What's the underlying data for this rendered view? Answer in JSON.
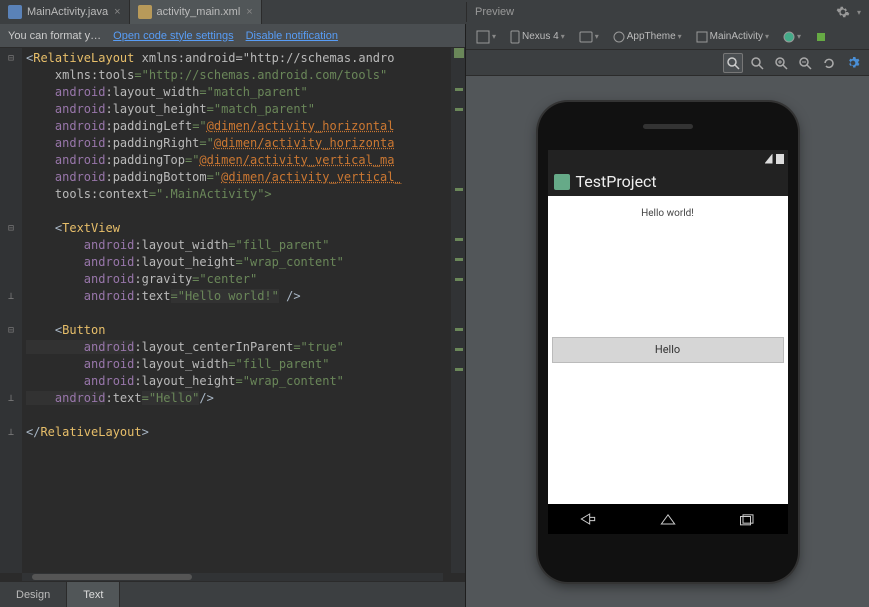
{
  "tabs": {
    "java": "MainActivity.java",
    "xml": "activity_main.xml"
  },
  "hint": {
    "text": "You can format y…",
    "link1": "Open code style settings",
    "link2": "Disable notification"
  },
  "code": {
    "l1a": "<",
    "l1b": "RelativeLayout",
    "l1c": " xmlns:android=\"http://schemas.andro",
    "l2a": "    xmlns:tools",
    "l2b": "=\"http://schemas.android.com/tools\"",
    "l3a": "    android",
    "l3b": ":layout_width",
    "l3c": "=\"match_parent\"",
    "l4a": "    android",
    "l4b": ":layout_height",
    "l4c": "=\"match_parent\"",
    "l5a": "    android",
    "l5b": ":paddingLeft",
    "l5c": "=\"",
    "l5d": "@dimen/activity_horizontal",
    "l6a": "    android",
    "l6b": ":paddingRight",
    "l6c": "=\"",
    "l6d": "@dimen/activity_horizonta",
    "l7a": "    android",
    "l7b": ":paddingTop",
    "l7c": "=\"",
    "l7d": "@dimen/activity_vertical_ma",
    "l8a": "    android",
    "l8b": ":paddingBottom",
    "l8c": "=\"",
    "l8d": "@dimen/activity_vertical_",
    "l9a": "    tools",
    "l9b": ":context",
    "l9c": "=\".MainActivity\">",
    "l11a": "    <",
    "l11b": "TextView",
    "l12a": "        android",
    "l12b": ":layout_width",
    "l12c": "=\"fill_parent\"",
    "l13a": "        android",
    "l13b": ":layout_height",
    "l13c": "=\"wrap_content\"",
    "l14a": "        android",
    "l14b": ":gravity",
    "l14c": "=\"center\"",
    "l15a": "        android",
    "l15b": ":text",
    "l15c": "=\"Hello world!\"",
    "l15d": " />",
    "l17a": "    <",
    "l17b": "Button",
    "l18a": "        android",
    "l18b": ":layout_centerInParent",
    "l18c": "=\"true\"",
    "l19a": "        android",
    "l19b": ":layout_width",
    "l19c": "=\"fill_parent\"",
    "l20a": "        android",
    "l20b": ":layout_height",
    "l20c": "=\"wrap_content\"",
    "l21a": "    android",
    "l21b": ":text",
    "l21c": "=\"Hello\"",
    "l21d": "/>",
    "l23a": "</",
    "l23b": "RelativeLayout",
    "l23c": ">"
  },
  "bottom_tabs": {
    "design": "Design",
    "text": "Text"
  },
  "preview": {
    "title": "Preview",
    "toolbar": {
      "device": "Nexus 4",
      "theme": "AppTheme",
      "activity": "MainActivity"
    },
    "app_title": "TestProject",
    "hello_world": "Hello world!",
    "button_label": "Hello"
  }
}
